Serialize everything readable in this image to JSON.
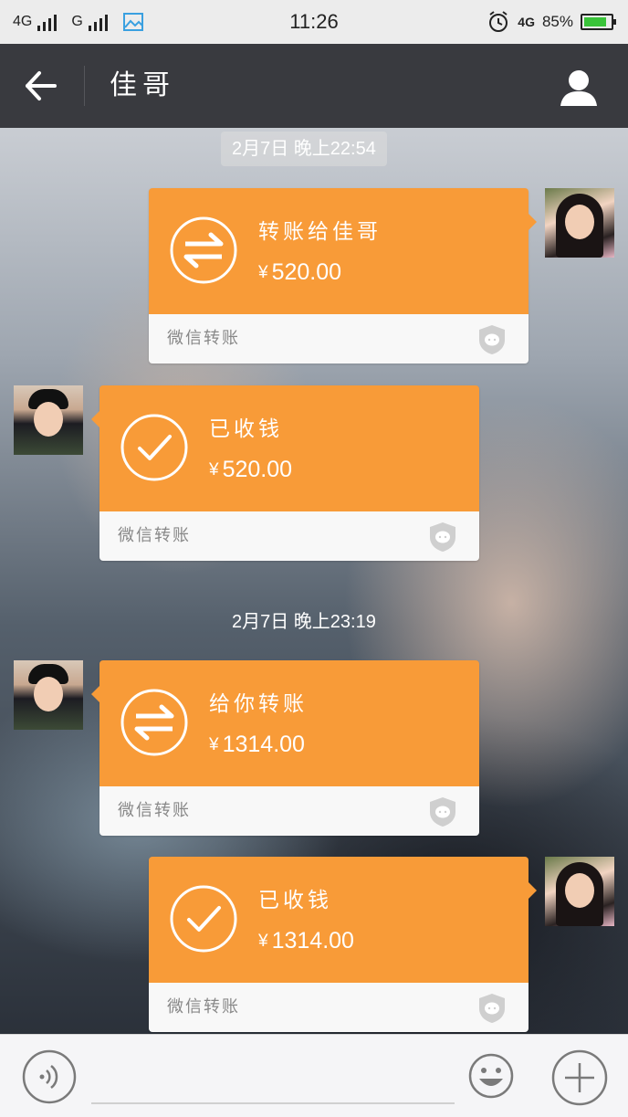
{
  "status_bar": {
    "left_network_1": "4G",
    "left_network_2": "G",
    "time": "11:26",
    "right_network": "4G",
    "battery": "85%",
    "battery_fill": 0.85
  },
  "header": {
    "title": "佳哥",
    "back_icon": "arrow-left-icon",
    "profile_icon": "person-icon"
  },
  "messages": [
    {
      "type": "timestamp",
      "text": "2月7日 晚上22:54"
    },
    {
      "type": "transfer",
      "side": "right",
      "icon": "transfer-arrows-icon",
      "title": "转账给佳哥",
      "yen": "¥",
      "amount": "520.00",
      "label": "微信转账"
    },
    {
      "type": "transfer",
      "side": "left",
      "icon": "check-circle-icon",
      "title": "已收钱",
      "yen": "¥",
      "amount": "520.00",
      "label": "微信转账"
    },
    {
      "type": "timestamp",
      "text": "2月7日 晚上23:19"
    },
    {
      "type": "transfer",
      "side": "left",
      "icon": "transfer-arrows-icon",
      "title": "给你转账",
      "yen": "¥",
      "amount": "1314.00",
      "label": "微信转账"
    },
    {
      "type": "transfer",
      "side": "right",
      "icon": "check-circle-icon",
      "title": "已收钱",
      "yen": "¥",
      "amount": "1314.00",
      "label": "微信转账"
    }
  ],
  "input_bar": {
    "voice_icon": "voice-icon",
    "emoji_icon": "emoji-icon",
    "plus_icon": "plus-icon"
  },
  "colors": {
    "card_orange": "#f89b38",
    "nav_bg": "#393a3f",
    "card_footer_bg": "#f8f8f8"
  }
}
